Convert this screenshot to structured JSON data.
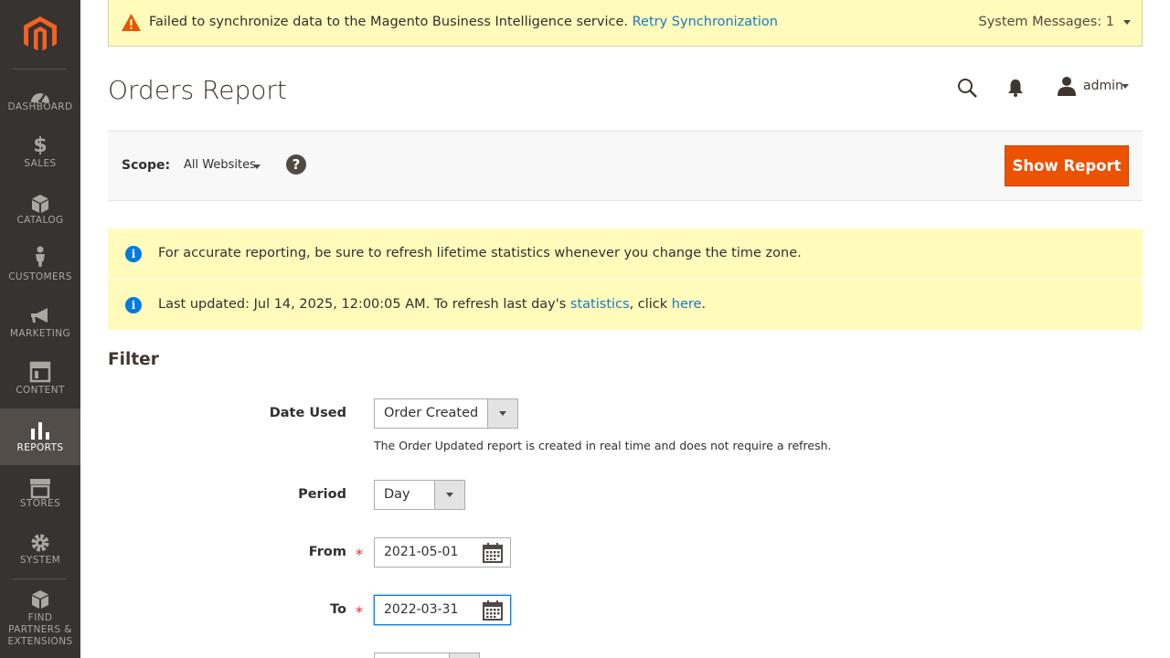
{
  "sidebar": {
    "items": [
      {
        "label": "DASHBOARD",
        "icon": "dashboard-icon"
      },
      {
        "label": "SALES",
        "icon": "dollar-icon"
      },
      {
        "label": "CATALOG",
        "icon": "box-icon"
      },
      {
        "label": "CUSTOMERS",
        "icon": "person-icon"
      },
      {
        "label": "MARKETING",
        "icon": "megaphone-icon"
      },
      {
        "label": "CONTENT",
        "icon": "layout-icon"
      },
      {
        "label": "REPORTS",
        "icon": "bar-chart-icon",
        "active": true
      },
      {
        "label": "STORES",
        "icon": "store-icon"
      },
      {
        "label": "SYSTEM",
        "icon": "gear-icon"
      }
    ],
    "partners": {
      "line1": "FIND",
      "line2": "PARTNERS &",
      "line3": "EXTENSIONS"
    }
  },
  "system_message": {
    "text": "Failed to synchronize data to the Magento Business Intelligence service.",
    "link": "Retry Synchronization",
    "count_label": "System Messages: 1"
  },
  "header": {
    "title": "Orders Report",
    "user": "admin"
  },
  "scope": {
    "label": "Scope:",
    "value": "All Websites",
    "help": "?",
    "button": "Show Report"
  },
  "messages": {
    "timezone": "For accurate reporting, be sure to refresh lifetime statistics whenever you change the time zone.",
    "updated_prefix": "Last updated: Jul 14, 2025, 12:00:05 AM. To refresh last day's",
    "updated_link1": "statistics",
    "updated_mid": ", click",
    "updated_link2": "here",
    "updated_suffix": "."
  },
  "filter": {
    "title": "Filter",
    "date_used_label": "Date Used",
    "date_used_value": "Order Created",
    "date_used_note": "The Order Updated report is created in real time and does not require a refresh.",
    "period_label": "Period",
    "period_value": "Day",
    "from_label": "From",
    "from_value": "2021-05-01",
    "to_label": "To",
    "to_value": "2022-03-31",
    "required_mark": "*"
  },
  "colors": {
    "sidebar_bg": "#373330",
    "accent": "#eb5202",
    "link": "#1979c3",
    "message_bg": "#fffbbb"
  }
}
